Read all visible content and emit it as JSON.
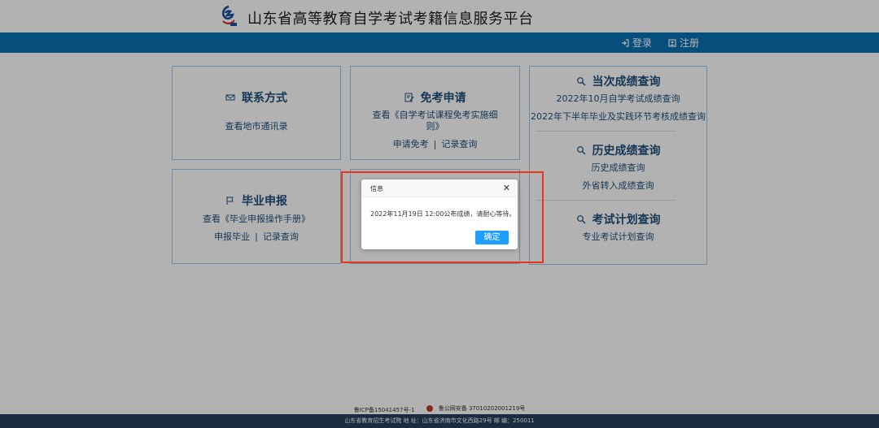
{
  "header": {
    "site_title": "山东省高等教育自学考试考籍信息服务平台",
    "logo_icon": "exam-authority-logo"
  },
  "nav": {
    "login_label": "登录",
    "register_label": "注册",
    "login_icon": "sign-in-icon",
    "register_icon": "id-card-icon"
  },
  "cards": {
    "contact": {
      "title": "联系方式",
      "icon": "envelope-icon",
      "link": "查看地市通讯录"
    },
    "exempt": {
      "title": "免考申请",
      "icon": "edit-document-icon",
      "rule_line1": "查看《自学考试课程免考实施细",
      "rule_line2": "则》",
      "apply": "申请免考",
      "separator": "|",
      "records": "记录查询"
    },
    "graduation": {
      "title": "毕业申报",
      "icon": "flag-icon",
      "manual": "查看《毕业申报操作手册》",
      "apply": "申报毕业",
      "separator": "|",
      "records": "记录查询"
    },
    "current_score": {
      "title": "当次成绩查询",
      "icon": "search-icon",
      "link1": "2022年10月自学考试成绩查询",
      "link2": "2022年下半年毕业及实践环节考核成绩查询"
    },
    "history_score": {
      "title": "历史成绩查询",
      "icon": "search-icon",
      "link1": "历史成绩查询",
      "link2": "外省转入成绩查询"
    },
    "exam_plan": {
      "title": "考试计划查询",
      "icon": "search-icon",
      "link1": "专业考试计划查询"
    }
  },
  "footer": {
    "icp": "鲁ICP备15041457号-1",
    "police": "鲁公网安备 37010202001219号",
    "address_line": "山东省教育招生考试院   地 址：山东省济南市文化西路29号   邮 编：250011"
  },
  "modal": {
    "title": "信息",
    "close": "✕",
    "message": "2022年11月19日 12:00公布成绩，请耐心等待。",
    "ok_label": "确定"
  },
  "colors": {
    "nav_bar": "#0a72b4",
    "footer_bar": "#26415c",
    "card_border": "#9dc9e6",
    "primary_button": "#1e9fff",
    "highlight_box": "#e8361e"
  }
}
